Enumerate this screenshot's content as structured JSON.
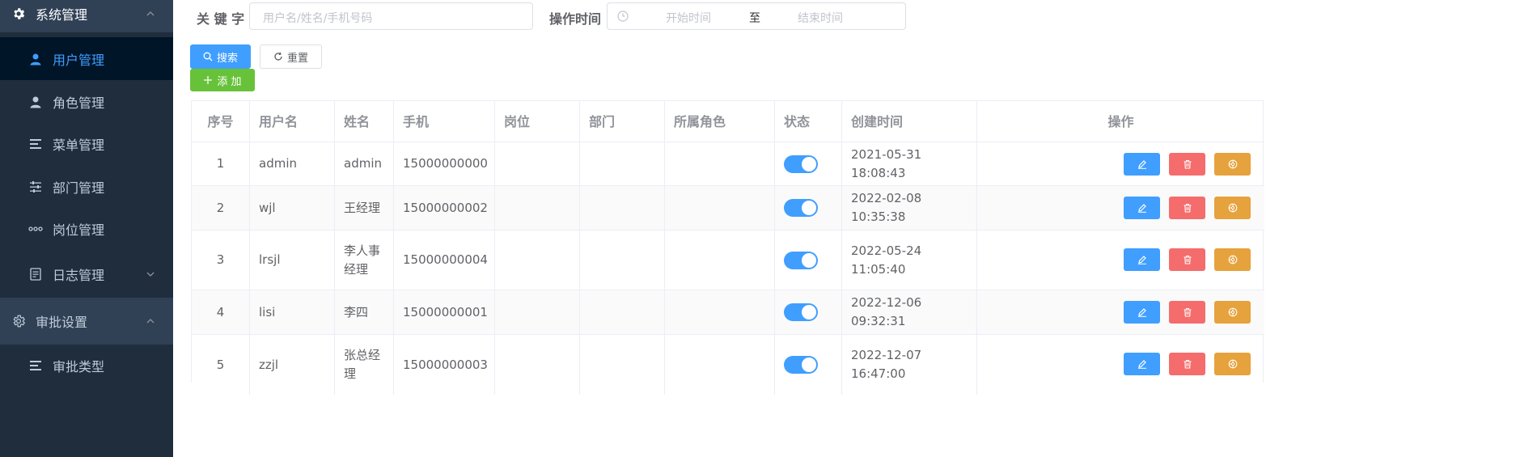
{
  "sidebar": {
    "group_system": {
      "label": "系统管理",
      "icon": "gear-icon"
    },
    "items": [
      {
        "label": "用户管理",
        "icon": "user-icon",
        "active": true
      },
      {
        "label": "角色管理",
        "icon": "user-icon"
      },
      {
        "label": "菜单管理",
        "icon": "menu-list-icon"
      },
      {
        "label": "部门管理",
        "icon": "sliders-icon"
      },
      {
        "label": "岗位管理",
        "icon": "more-dots-icon"
      },
      {
        "label": "日志管理",
        "icon": "document-icon"
      }
    ],
    "group_approval": {
      "label": "审批设置",
      "icon": "settings-outline-icon"
    },
    "approval_items": [
      {
        "label": "审批类型",
        "icon": "menu-list-icon"
      }
    ]
  },
  "search": {
    "keyword_label": "关 键 字",
    "keyword_placeholder": "用户名/姓名/手机号码",
    "time_label": "操作时间",
    "start_placeholder": "开始时间",
    "separator": "至",
    "end_placeholder": "结束时间",
    "search_button": "搜索",
    "reset_button": "重置",
    "add_button": "添 加"
  },
  "table": {
    "headers": {
      "index": "序号",
      "username": "用户名",
      "name": "姓名",
      "phone": "手机",
      "post": "岗位",
      "dept": "部门",
      "role": "所属角色",
      "status": "状态",
      "created": "创建时间",
      "actions": "操作"
    },
    "rows": [
      {
        "index": "1",
        "username": "admin",
        "name": "admin",
        "phone": "15000000000",
        "post": "",
        "dept": "",
        "role": "",
        "status": true,
        "created": "2021-05-31 18:08:43"
      },
      {
        "index": "2",
        "username": "wjl",
        "name": "王经理",
        "phone": "15000000002",
        "post": "",
        "dept": "",
        "role": "",
        "status": true,
        "created": "2022-02-08 10:35:38"
      },
      {
        "index": "3",
        "username": "lrsjl",
        "name": "李人事经理",
        "phone": "15000000004",
        "post": "",
        "dept": "",
        "role": "",
        "status": true,
        "created": "2022-05-24 11:05:40"
      },
      {
        "index": "4",
        "username": "lisi",
        "name": "李四",
        "phone": "15000000001",
        "post": "",
        "dept": "",
        "role": "",
        "status": true,
        "created": "2022-12-06 09:32:31"
      },
      {
        "index": "5",
        "username": "zzjl",
        "name": "张总经理",
        "phone": "15000000003",
        "post": "",
        "dept": "",
        "role": "",
        "status": true,
        "created": "2022-12-07 16:47:00"
      }
    ]
  },
  "colors": {
    "primary": "#409eff",
    "danger": "#f56c6c",
    "warning": "#e6a23c",
    "success": "#67c23a",
    "sidebar_bg": "#1f2d3d"
  }
}
